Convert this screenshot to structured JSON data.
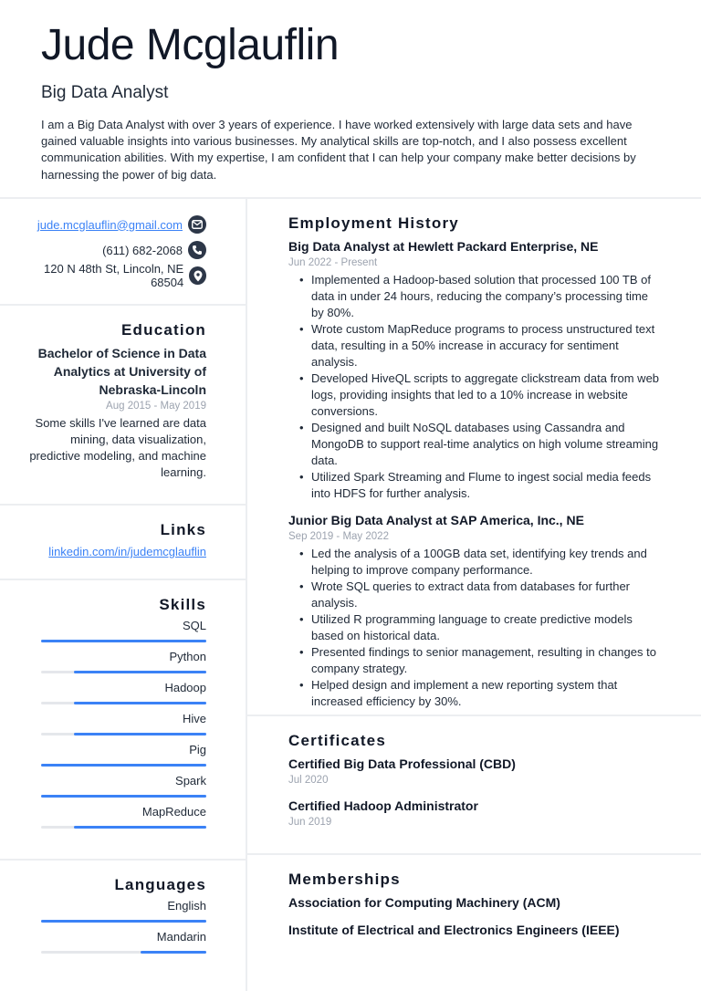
{
  "header": {
    "name": "Jude Mcglauflin",
    "title": "Big Data Analyst",
    "summary": "I am a Big Data Analyst with over 3 years of experience. I have worked extensively with large data sets and have gained valuable insights into various businesses. My analytical skills are top-notch, and I also possess excellent communication abilities. With my expertise, I am confident that I can help your company make better decisions by harnessing the power of big data."
  },
  "contact": {
    "email": "jude.mcglauflin@gmail.com",
    "phone": "(611) 682-2068",
    "address": "120 N 48th St, Lincoln, NE 68504",
    "icons": [
      "envelope-icon",
      "phone-icon",
      "map-pin-icon"
    ]
  },
  "education": {
    "title": "Education",
    "degree": "Bachelor of Science in Data Analytics at University of Nebraska-Lincoln",
    "dates": "Aug 2015 - May 2019",
    "description": "Some skills I've learned are data mining, data visualization, predictive modeling, and machine learning."
  },
  "links": {
    "title": "Links",
    "items": [
      "linkedin.com/in/judemcglauflin"
    ]
  },
  "skills": {
    "title": "Skills",
    "items": [
      {
        "name": "SQL",
        "level": 1.0
      },
      {
        "name": "Python",
        "level": 0.8
      },
      {
        "name": "Hadoop",
        "level": 0.8
      },
      {
        "name": "Hive",
        "level": 0.8
      },
      {
        "name": "Pig",
        "level": 1.0
      },
      {
        "name": "Spark",
        "level": 1.0
      },
      {
        "name": "MapReduce",
        "level": 0.8
      }
    ]
  },
  "languages": {
    "title": "Languages",
    "items": [
      {
        "name": "English",
        "level": 1.0
      },
      {
        "name": "Mandarin",
        "level": 0.4
      }
    ]
  },
  "employment": {
    "title": "Employment History",
    "jobs": [
      {
        "heading": "Big Data Analyst at Hewlett Packard Enterprise, NE",
        "dates": "Jun 2022 - Present",
        "bullets": [
          "Implemented a Hadoop-based solution that processed 100 TB of data in under 24 hours, reducing the company’s processing time by 80%.",
          "Wrote custom MapReduce programs to process unstructured text data, resulting in a 50% increase in accuracy for sentiment analysis.",
          "Developed HiveQL scripts to aggregate clickstream data from web logs, providing insights that led to a 10% increase in website conversions.",
          "Designed and built NoSQL databases using Cassandra and MongoDB to support real-time analytics on high volume streaming data.",
          "Utilized Spark Streaming and Flume to ingest social media feeds into HDFS for further analysis."
        ]
      },
      {
        "heading": "Junior Big Data Analyst at SAP America, Inc., NE",
        "dates": "Sep 2019 - May 2022",
        "bullets": [
          "Led the analysis of a 100GB data set, identifying key trends and helping to improve company performance.",
          "Wrote SQL queries to extract data from databases for further analysis.",
          "Utilized R programming language to create predictive models based on historical data.",
          "Presented findings to senior management, resulting in changes to company strategy.",
          "Helped design and implement a new reporting system that increased efficiency by 30%."
        ]
      }
    ]
  },
  "certificates": {
    "title": "Certificates",
    "items": [
      {
        "name": "Certified Big Data Professional (CBD)",
        "date": "Jul 2020"
      },
      {
        "name": "Certified Hadoop Administrator",
        "date": "Jun 2019"
      }
    ]
  },
  "memberships": {
    "title": "Memberships",
    "items": [
      "Association for Computing Machinery (ACM)",
      "Institute of Electrical and Electronics Engineers (IEEE)"
    ]
  },
  "colors": {
    "accent": "#3b82f6",
    "track": "#e5e7eb",
    "muted": "#9ca3af",
    "text": "#1f2937",
    "icon_bg": "#2d3748"
  }
}
